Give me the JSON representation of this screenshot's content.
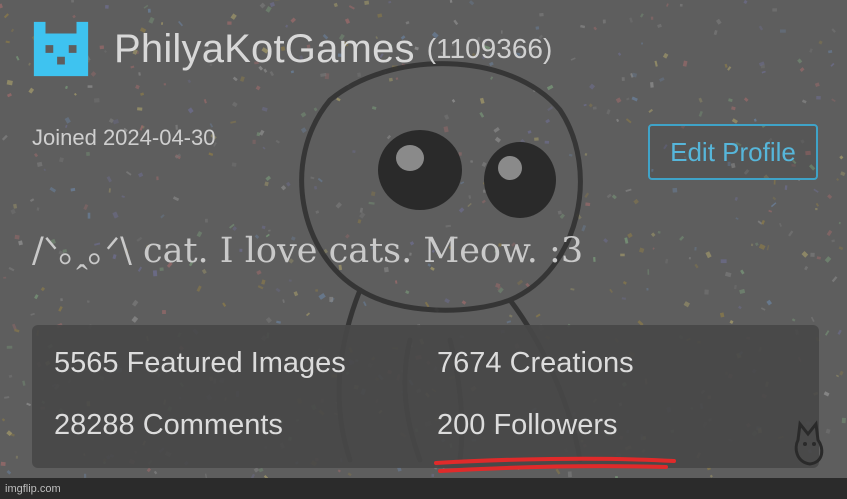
{
  "profile": {
    "username": "PhilyaKotGames",
    "user_id": "(1109366)",
    "joined": "Joined 2024-04-30",
    "bio": "/ᐠ｡ꞈ｡ᐟ\\ cat. I love cats. Meow. :3",
    "edit_button_label": "Edit Profile"
  },
  "stats": {
    "featured_images": "5565 Featured Images",
    "creations": "7674 Creations",
    "comments": "28288 Comments",
    "followers": "200 Followers"
  },
  "icons": {
    "site_logo": "pixel-cat-logo-icon",
    "corner_doodle": "cat-doodle-icon"
  },
  "colors": {
    "accent": "#3fa3c8",
    "logo": "#3ec3f0",
    "underline": "#e02a2a"
  },
  "watermark": "imgflip.com"
}
